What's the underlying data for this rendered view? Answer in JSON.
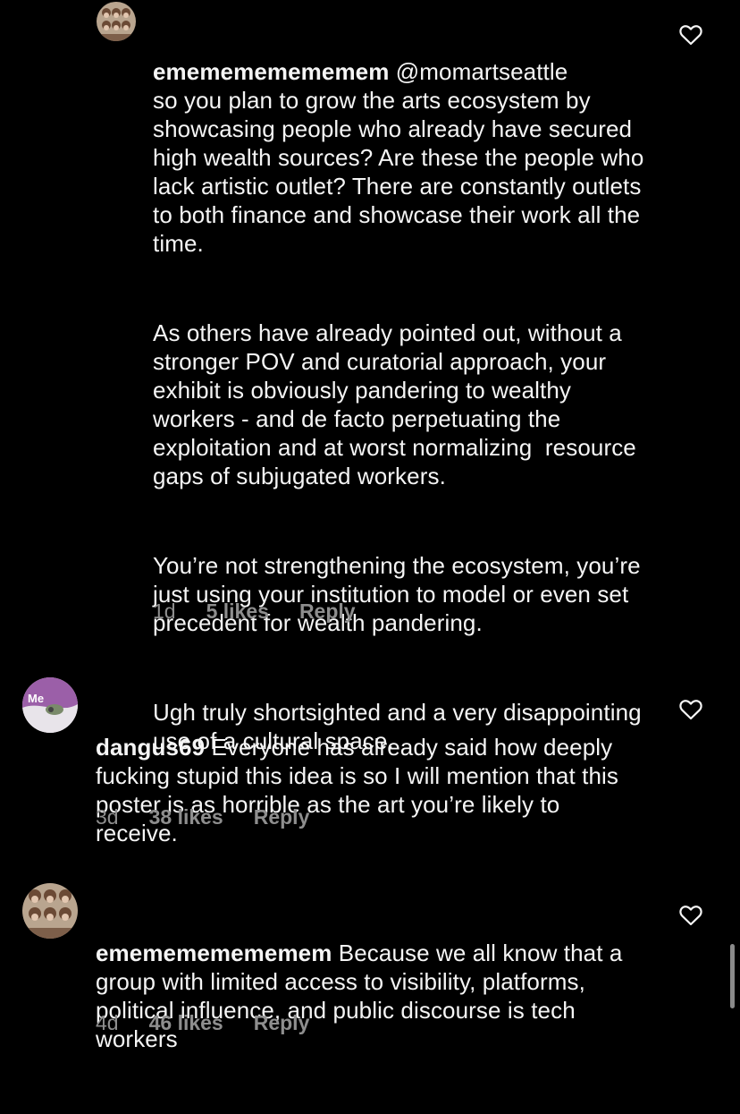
{
  "comments": [
    {
      "username": "ememememememem",
      "mention": "@momartseattle",
      "paragraphs": [
        "so you plan to grow the arts ecosystem by showcasing people who already have secured high wealth sources? Are these the people who lack artistic outlet? There are constantly outlets to both finance and showcase their work all the time.",
        "As others have already pointed out, without a stronger POV and curatorial approach, your exhibit is obviously pandering to wealthy workers - and de facto perpetuating the exploitation and at worst normalizing  resource gaps of subjugated workers.",
        "You’re not strengthening the ecosystem, you’re just using your institution to model or even set precedent for wealth pandering.",
        "Ugh truly shortsighted and a very disappointing use of a cultural space."
      ],
      "time": "1d",
      "likes": "5 likes",
      "reply": "Reply"
    },
    {
      "username": "dangus69",
      "avatar_text": "Me",
      "text": "Everyone has already said how deeply fucking stupid this idea is so I will mention that this poster is as horrible as the art you’re likely to receive.",
      "time": "3d",
      "likes": "38 likes",
      "reply": "Reply"
    },
    {
      "username": "ememememememem",
      "text": "Because we all know that a group with limited access to visibility, platforms, political influence, and public discourse is tech workers",
      "time": "4d",
      "likes": "46 likes",
      "reply": "Reply"
    }
  ],
  "icons": {
    "like": "heart-outline-icon"
  },
  "colors": {
    "background": "#000000",
    "text": "#f5f5f5",
    "meta": "#8e8e8e"
  }
}
